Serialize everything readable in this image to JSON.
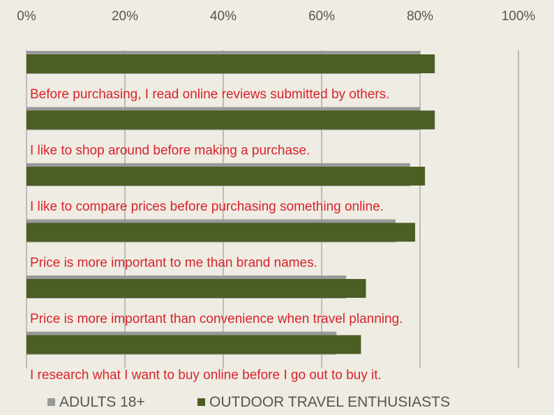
{
  "chart_data": {
    "type": "bar",
    "orientation": "horizontal",
    "categories": [
      "Before purchasing, I read online reviews submitted by others.",
      "I like to shop around before making a purchase.",
      "I like to compare prices before purchasing something online.",
      "Price is more important to me than brand names.",
      "Price is more important than convenience when travel planning.",
      "I research what I want to buy online before I go out to buy it."
    ],
    "series": [
      {
        "name": "ADULTS 18+",
        "color": "#999999",
        "values": [
          80,
          80,
          78,
          75,
          65,
          63
        ]
      },
      {
        "name": "OUTDOOR TRAVEL ENTHUSIASTS",
        "color": "#4b5e23",
        "values": [
          83,
          83,
          81,
          79,
          69,
          68
        ]
      }
    ],
    "xlim": [
      0,
      100
    ],
    "xticks": [
      "0%",
      "20%",
      "40%",
      "60%",
      "80%",
      "100%"
    ],
    "grid": true,
    "legend": "bottom",
    "category_label_color": "#d8232a"
  }
}
